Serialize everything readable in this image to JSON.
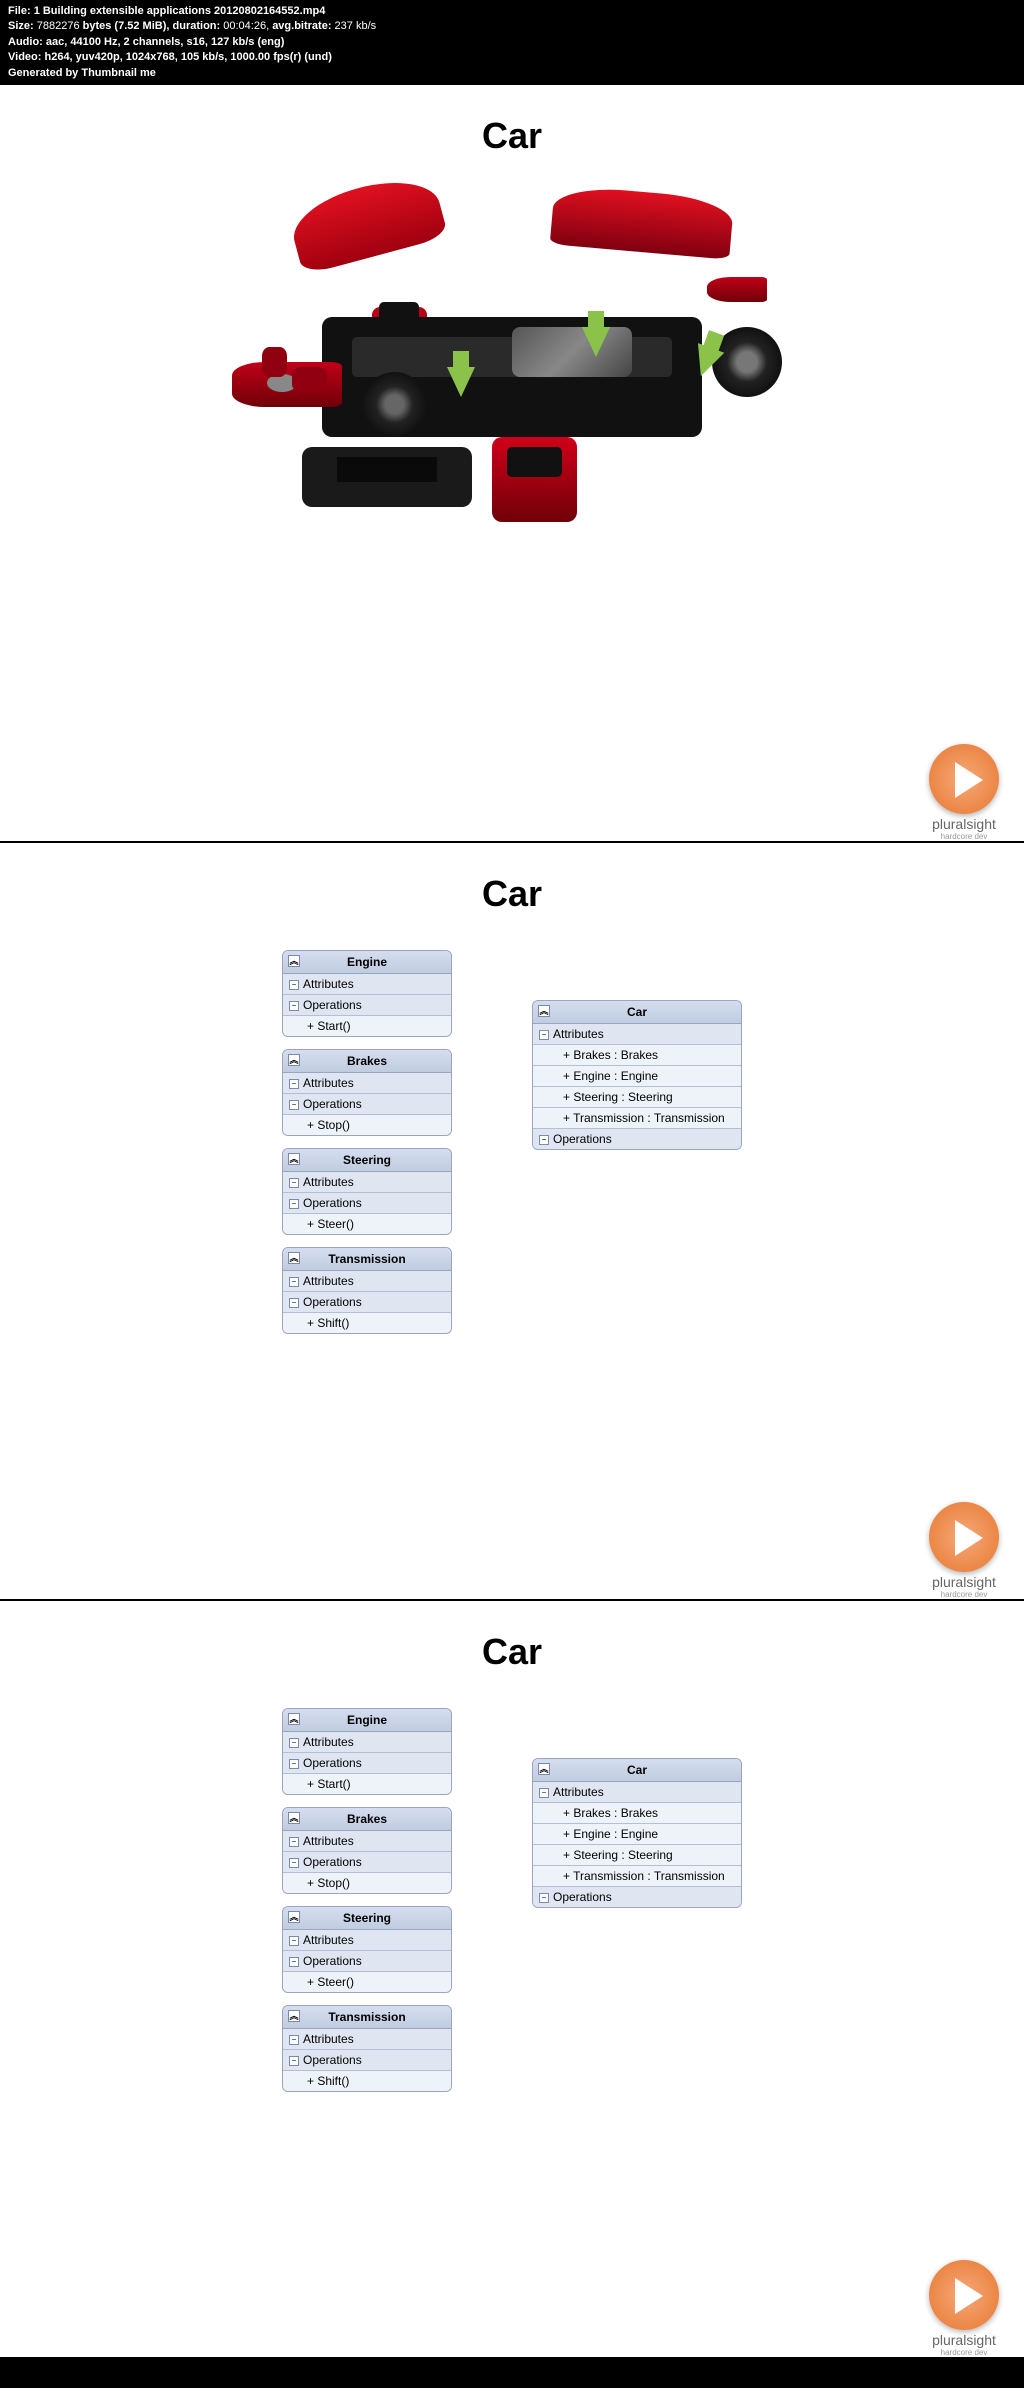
{
  "header": {
    "file_label": "File:",
    "file_value": "1 Building extensible applications 20120802164552.mp4",
    "size_label": "Size:",
    "size_bytes": "7882276",
    "size_unit": "bytes (7.52 MiB),",
    "duration_label": "duration:",
    "duration_value": "00:04:26,",
    "bitrate_label": "avg.bitrate:",
    "bitrate_value": "237 kb/s",
    "audio_label": "Audio:",
    "audio_value": "aac, 44100 Hz, 2 channels, s16, 127 kb/s (eng)",
    "video_label": "Video:",
    "video_value": "h264, yuv420p, 1024x768, 105 kb/s, 1000.00 fps(r) (und)",
    "gen_label": "Generated by Thumbnail me"
  },
  "slides": {
    "title": "Car"
  },
  "logo": {
    "text": "pluralsight",
    "sub": "hardcore dev"
  },
  "uml": {
    "attributes_label": "Attributes",
    "operations_label": "Operations",
    "minus": "−",
    "chev": "︽",
    "engine": {
      "title": "Engine",
      "op": "+ Start()"
    },
    "brakes": {
      "title": "Brakes",
      "op": "+ Stop()"
    },
    "steering": {
      "title": "Steering",
      "op": "+ Steer()"
    },
    "transmission": {
      "title": "Transmission",
      "op": "+ Shift()"
    },
    "car": {
      "title": "Car",
      "a1": "+ Brakes : Brakes",
      "a2": "+ Engine : Engine",
      "a3": "+ Steering : Steering",
      "a4": "+ Transmission : Transmission"
    }
  },
  "chart_data": {
    "type": "table",
    "title": "UML class diagram — Car composition",
    "classes": [
      {
        "name": "Engine",
        "attributes": [],
        "operations": [
          "Start()"
        ]
      },
      {
        "name": "Brakes",
        "attributes": [],
        "operations": [
          "Stop()"
        ]
      },
      {
        "name": "Steering",
        "attributes": [],
        "operations": [
          "Steer()"
        ]
      },
      {
        "name": "Transmission",
        "attributes": [],
        "operations": [
          "Shift()"
        ]
      },
      {
        "name": "Car",
        "attributes": [
          "Brakes : Brakes",
          "Engine : Engine",
          "Steering : Steering",
          "Transmission : Transmission"
        ],
        "operations": []
      }
    ]
  }
}
